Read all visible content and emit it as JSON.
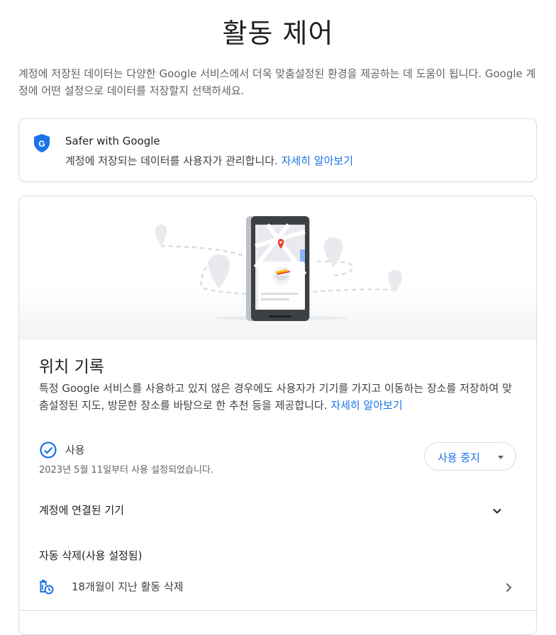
{
  "page": {
    "title": "활동 제어",
    "intro": "계정에 저장된 데이터는 다양한 Google 서비스에서 더욱 맞춤설정된 환경을 제공하는 데 도움이 됩니다. Google 계정에 어떤 설정으로 데이터를 저장할지 선택하세요."
  },
  "safer": {
    "icon": "google-shield-icon",
    "title": "Safer with Google",
    "desc": "계정에 저장되는 데이터를 사용자가 관리합니다.",
    "link": "자세히 알아보기"
  },
  "location": {
    "title": "위치 기록",
    "desc": "특정 Google 서비스를 사용하고 있지 않은 경우에도 사용자가 기기를 가지고 이동하는 장소를 저장하여 맞춤설정된 지도, 방문한 장소를 바탕으로 한 추천 등을 제공합니다.",
    "desc_link": "자세히 알아보기",
    "status_label": "사용",
    "status_date": "2023년 5월 11일부터 사용 설정되었습니다.",
    "pause_button": "사용 중지",
    "devices_label": "계정에 연결된 기기",
    "autodelete_title": "자동 삭제(사용 설정됨)",
    "autodelete_item": "18개월이 지난 활동 삭제"
  },
  "colors": {
    "accent": "#1a73e8",
    "text": "#202124",
    "secondary": "#5f6368",
    "border": "#dadce0"
  }
}
